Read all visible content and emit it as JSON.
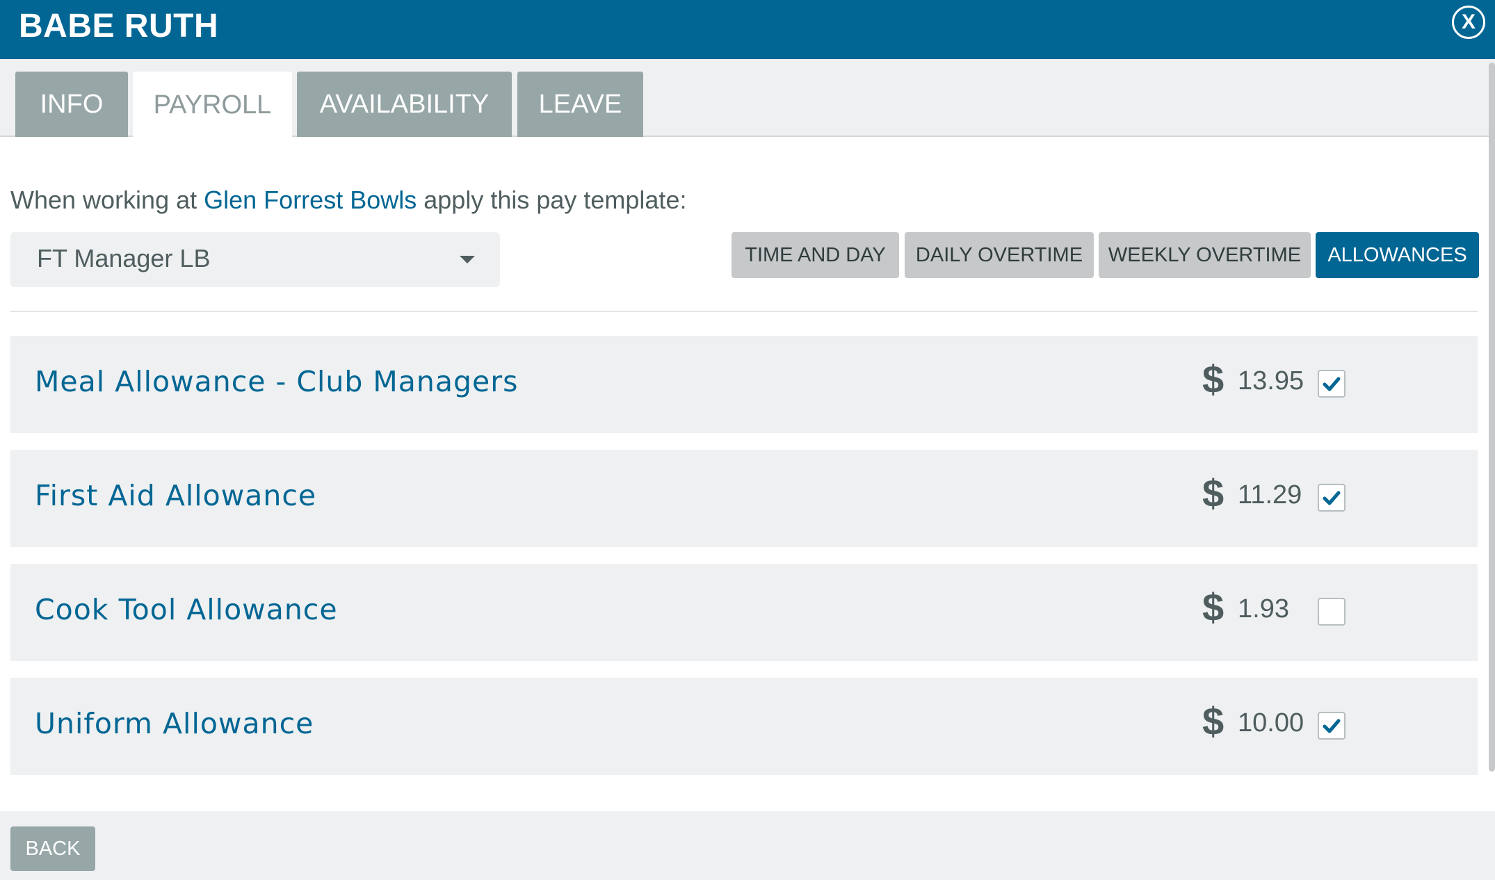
{
  "header": {
    "title": "BABE RUTH",
    "close_label": "X"
  },
  "tabs": [
    {
      "label": "INFO",
      "active": false
    },
    {
      "label": "PAYROLL",
      "active": true
    },
    {
      "label": "AVAILABILITY",
      "active": false
    },
    {
      "label": "LEAVE",
      "active": false
    }
  ],
  "payroll": {
    "instruction_prefix": "When working at",
    "location": "Glen Forrest Bowls",
    "instruction_suffix": "apply this pay template:",
    "template_select": {
      "value": "FT Manager LB"
    },
    "sub_tabs": [
      {
        "label": "TIME AND DAY",
        "active": false
      },
      {
        "label": "DAILY OVERTIME",
        "active": false
      },
      {
        "label": "WEEKLY OVERTIME",
        "active": false
      },
      {
        "label": "ALLOWANCES",
        "active": true
      }
    ],
    "currency_symbol": "$",
    "allowances": [
      {
        "name": "Meal Allowance - Club Managers",
        "amount": "13.95",
        "checked": true
      },
      {
        "name": "First Aid Allowance",
        "amount": "11.29",
        "checked": true
      },
      {
        "name": "Cook Tool Allowance",
        "amount": "1.93",
        "checked": false
      },
      {
        "name": "Uniform Allowance",
        "amount": "10.00",
        "checked": true
      }
    ]
  },
  "footer": {
    "back_label": "BACK"
  },
  "colors": {
    "brand": "#016694",
    "tab_inactive": "#97a6a6",
    "panel": "#eef0f1",
    "text": "#4f5d5f"
  }
}
